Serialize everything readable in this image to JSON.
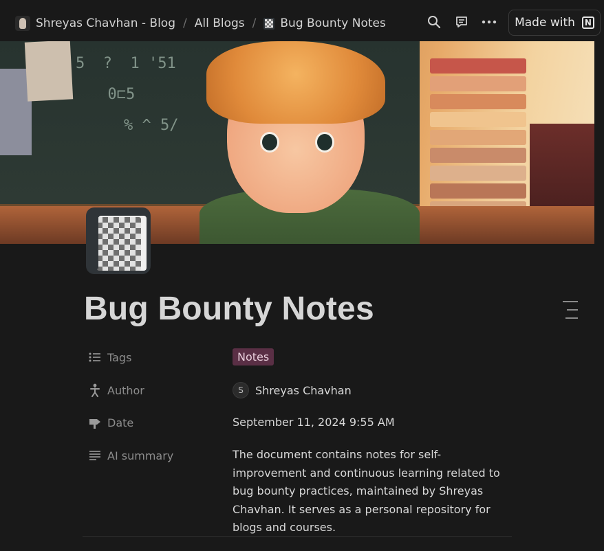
{
  "breadcrumb": {
    "items": [
      {
        "label": "Shreyas Chavhan - Blog",
        "icon": "avatar-photo"
      },
      {
        "label": "All Blogs"
      },
      {
        "label": "Bug Bounty Notes",
        "icon": "notebook-icon"
      }
    ],
    "separator": "/"
  },
  "toolbar": {
    "icons": [
      "search-icon",
      "comment-icon",
      "more-icon"
    ],
    "made_with_label": "Made with",
    "made_with_logo": "N"
  },
  "page": {
    "title": "Bug Bounty Notes",
    "icon": "notebook-icon"
  },
  "properties": {
    "tags": {
      "label": "Tags",
      "value": "Notes",
      "color": "#5a2f45"
    },
    "author": {
      "label": "Author",
      "initial": "S",
      "name": "Shreyas Chavhan"
    },
    "date": {
      "label": "Date",
      "value": "September 11, 2024 9:55 AM"
    },
    "ai_summary": {
      "label": "AI summary",
      "value": "The document contains notes for self-improvement and continuous learning related to bug bounty practices, maintained by Shreyas Chavhan. It serves as a personal repository for blogs and courses."
    }
  },
  "colors": {
    "background": "#191919",
    "text": "#d4d4d4",
    "muted": "#8c8c8c"
  }
}
